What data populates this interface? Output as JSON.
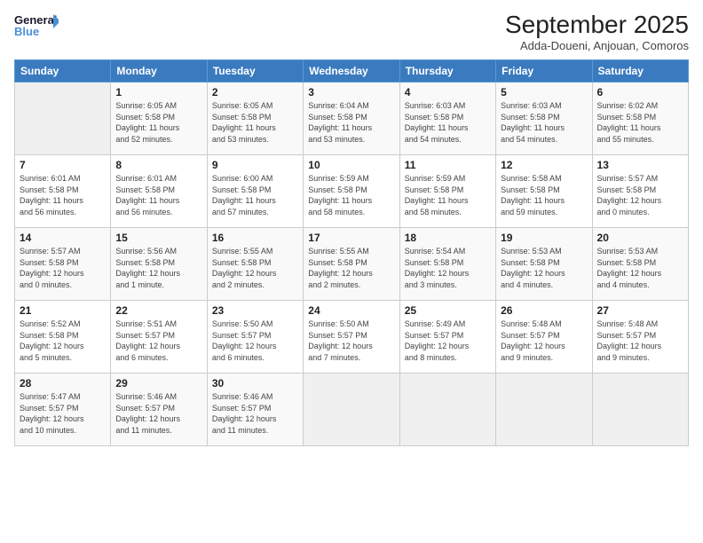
{
  "logo": {
    "text_general": "General",
    "text_blue": "Blue"
  },
  "title": "September 2025",
  "location": "Adda-Doueni, Anjouan, Comoros",
  "header_days": [
    "Sunday",
    "Monday",
    "Tuesday",
    "Wednesday",
    "Thursday",
    "Friday",
    "Saturday"
  ],
  "weeks": [
    [
      {
        "day": "",
        "info": ""
      },
      {
        "day": "1",
        "info": "Sunrise: 6:05 AM\nSunset: 5:58 PM\nDaylight: 11 hours\nand 52 minutes."
      },
      {
        "day": "2",
        "info": "Sunrise: 6:05 AM\nSunset: 5:58 PM\nDaylight: 11 hours\nand 53 minutes."
      },
      {
        "day": "3",
        "info": "Sunrise: 6:04 AM\nSunset: 5:58 PM\nDaylight: 11 hours\nand 53 minutes."
      },
      {
        "day": "4",
        "info": "Sunrise: 6:03 AM\nSunset: 5:58 PM\nDaylight: 11 hours\nand 54 minutes."
      },
      {
        "day": "5",
        "info": "Sunrise: 6:03 AM\nSunset: 5:58 PM\nDaylight: 11 hours\nand 54 minutes."
      },
      {
        "day": "6",
        "info": "Sunrise: 6:02 AM\nSunset: 5:58 PM\nDaylight: 11 hours\nand 55 minutes."
      }
    ],
    [
      {
        "day": "7",
        "info": "Sunrise: 6:01 AM\nSunset: 5:58 PM\nDaylight: 11 hours\nand 56 minutes."
      },
      {
        "day": "8",
        "info": "Sunrise: 6:01 AM\nSunset: 5:58 PM\nDaylight: 11 hours\nand 56 minutes."
      },
      {
        "day": "9",
        "info": "Sunrise: 6:00 AM\nSunset: 5:58 PM\nDaylight: 11 hours\nand 57 minutes."
      },
      {
        "day": "10",
        "info": "Sunrise: 5:59 AM\nSunset: 5:58 PM\nDaylight: 11 hours\nand 58 minutes."
      },
      {
        "day": "11",
        "info": "Sunrise: 5:59 AM\nSunset: 5:58 PM\nDaylight: 11 hours\nand 58 minutes."
      },
      {
        "day": "12",
        "info": "Sunrise: 5:58 AM\nSunset: 5:58 PM\nDaylight: 11 hours\nand 59 minutes."
      },
      {
        "day": "13",
        "info": "Sunrise: 5:57 AM\nSunset: 5:58 PM\nDaylight: 12 hours\nand 0 minutes."
      }
    ],
    [
      {
        "day": "14",
        "info": "Sunrise: 5:57 AM\nSunset: 5:58 PM\nDaylight: 12 hours\nand 0 minutes."
      },
      {
        "day": "15",
        "info": "Sunrise: 5:56 AM\nSunset: 5:58 PM\nDaylight: 12 hours\nand 1 minute."
      },
      {
        "day": "16",
        "info": "Sunrise: 5:55 AM\nSunset: 5:58 PM\nDaylight: 12 hours\nand 2 minutes."
      },
      {
        "day": "17",
        "info": "Sunrise: 5:55 AM\nSunset: 5:58 PM\nDaylight: 12 hours\nand 2 minutes."
      },
      {
        "day": "18",
        "info": "Sunrise: 5:54 AM\nSunset: 5:58 PM\nDaylight: 12 hours\nand 3 minutes."
      },
      {
        "day": "19",
        "info": "Sunrise: 5:53 AM\nSunset: 5:58 PM\nDaylight: 12 hours\nand 4 minutes."
      },
      {
        "day": "20",
        "info": "Sunrise: 5:53 AM\nSunset: 5:58 PM\nDaylight: 12 hours\nand 4 minutes."
      }
    ],
    [
      {
        "day": "21",
        "info": "Sunrise: 5:52 AM\nSunset: 5:58 PM\nDaylight: 12 hours\nand 5 minutes."
      },
      {
        "day": "22",
        "info": "Sunrise: 5:51 AM\nSunset: 5:57 PM\nDaylight: 12 hours\nand 6 minutes."
      },
      {
        "day": "23",
        "info": "Sunrise: 5:50 AM\nSunset: 5:57 PM\nDaylight: 12 hours\nand 6 minutes."
      },
      {
        "day": "24",
        "info": "Sunrise: 5:50 AM\nSunset: 5:57 PM\nDaylight: 12 hours\nand 7 minutes."
      },
      {
        "day": "25",
        "info": "Sunrise: 5:49 AM\nSunset: 5:57 PM\nDaylight: 12 hours\nand 8 minutes."
      },
      {
        "day": "26",
        "info": "Sunrise: 5:48 AM\nSunset: 5:57 PM\nDaylight: 12 hours\nand 9 minutes."
      },
      {
        "day": "27",
        "info": "Sunrise: 5:48 AM\nSunset: 5:57 PM\nDaylight: 12 hours\nand 9 minutes."
      }
    ],
    [
      {
        "day": "28",
        "info": "Sunrise: 5:47 AM\nSunset: 5:57 PM\nDaylight: 12 hours\nand 10 minutes."
      },
      {
        "day": "29",
        "info": "Sunrise: 5:46 AM\nSunset: 5:57 PM\nDaylight: 12 hours\nand 11 minutes."
      },
      {
        "day": "30",
        "info": "Sunrise: 5:46 AM\nSunset: 5:57 PM\nDaylight: 12 hours\nand 11 minutes."
      },
      {
        "day": "",
        "info": ""
      },
      {
        "day": "",
        "info": ""
      },
      {
        "day": "",
        "info": ""
      },
      {
        "day": "",
        "info": ""
      }
    ]
  ]
}
